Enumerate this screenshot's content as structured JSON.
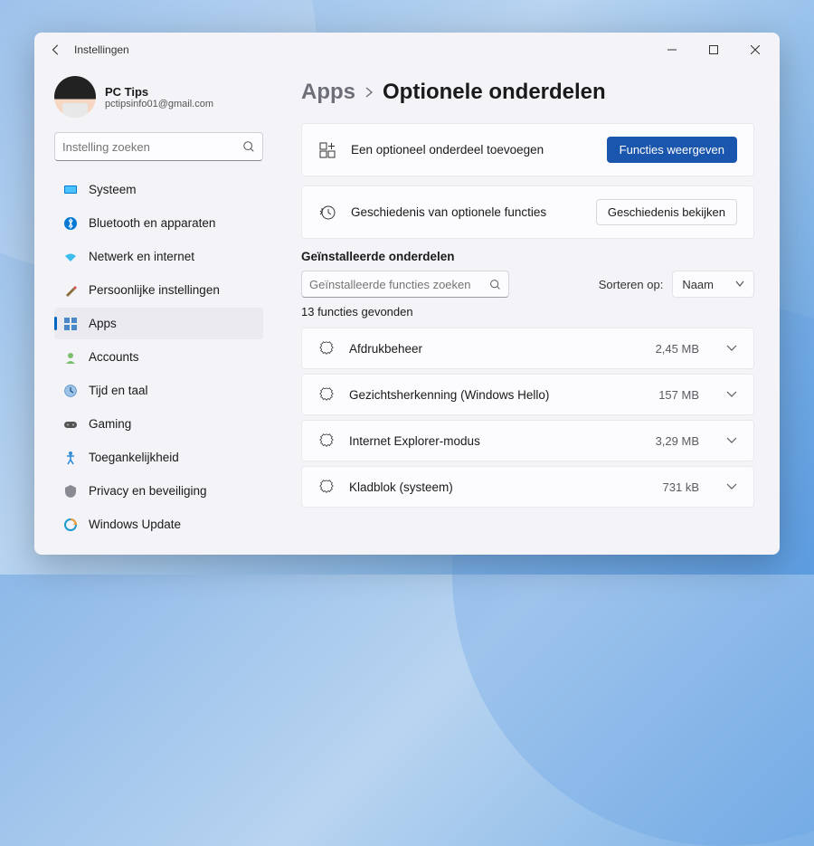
{
  "window": {
    "title": "Instellingen"
  },
  "profile": {
    "name": "PC Tips",
    "email": "pctipsinfo01@gmail.com"
  },
  "search": {
    "placeholder": "Instelling zoeken"
  },
  "nav": {
    "items": [
      {
        "label": "Systeem",
        "icon": "system"
      },
      {
        "label": "Bluetooth en apparaten",
        "icon": "bluetooth"
      },
      {
        "label": "Netwerk en internet",
        "icon": "network"
      },
      {
        "label": "Persoonlijke instellingen",
        "icon": "personalization"
      },
      {
        "label": "Apps",
        "icon": "apps",
        "active": true
      },
      {
        "label": "Accounts",
        "icon": "accounts"
      },
      {
        "label": "Tijd en taal",
        "icon": "time"
      },
      {
        "label": "Gaming",
        "icon": "gaming"
      },
      {
        "label": "Toegankelijkheid",
        "icon": "accessibility"
      },
      {
        "label": "Privacy en beveiliging",
        "icon": "privacy"
      },
      {
        "label": "Windows Update",
        "icon": "update"
      }
    ]
  },
  "breadcrumb": {
    "parent": "Apps",
    "current": "Optionele onderdelen"
  },
  "cards": {
    "add": {
      "label": "Een optioneel onderdeel toevoegen",
      "button": "Functies weergeven"
    },
    "history": {
      "label": "Geschiedenis van optionele functies",
      "button": "Geschiedenis bekijken"
    }
  },
  "installed": {
    "title": "Geïnstalleerde onderdelen",
    "search_placeholder": "Geïnstalleerde functies zoeken",
    "sort_label": "Sorteren op:",
    "sort_value": "Naam",
    "count_text": "13 functies gevonden",
    "items": [
      {
        "name": "Afdrukbeheer",
        "size": "2,45 MB"
      },
      {
        "name": "Gezichtsherkenning (Windows Hello)",
        "size": "157 MB"
      },
      {
        "name": "Internet Explorer-modus",
        "size": "3,29 MB"
      },
      {
        "name": "Kladblok (systeem)",
        "size": "731 kB"
      }
    ]
  }
}
